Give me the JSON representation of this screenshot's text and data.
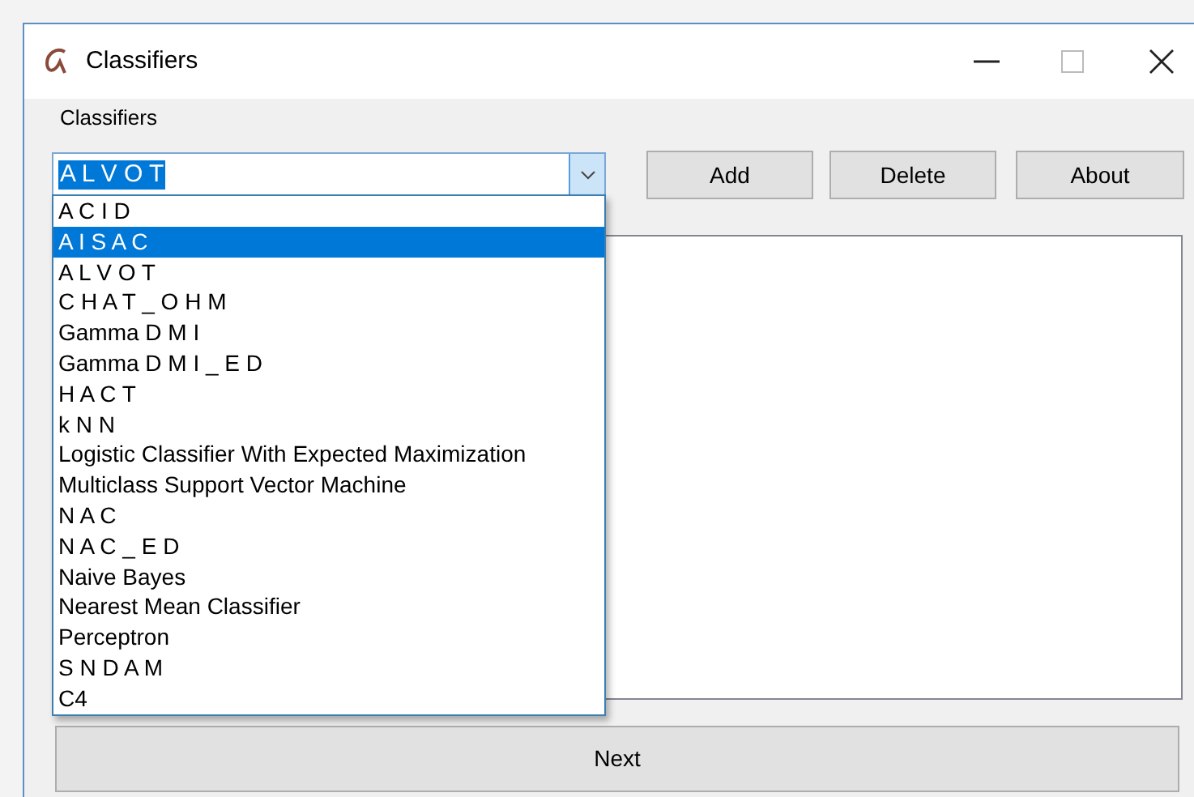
{
  "window": {
    "title": "Classifiers"
  },
  "group_label": "Classifiers",
  "combo": {
    "value": "A L V O T",
    "expanded": true
  },
  "dropdown_items": [
    {
      "label": "A C I D",
      "selected": false
    },
    {
      "label": "A I S A C",
      "selected": true
    },
    {
      "label": "A L V O T",
      "selected": false
    },
    {
      "label": "C H A T _ O H M",
      "selected": false
    },
    {
      "label": "Gamma D M I",
      "selected": false
    },
    {
      "label": "Gamma D M I _ E D",
      "selected": false
    },
    {
      "label": "H A C T",
      "selected": false
    },
    {
      "label": "k N N",
      "selected": false
    },
    {
      "label": "Logistic Classifier With Expected Maximization",
      "selected": false
    },
    {
      "label": "Multiclass Support Vector Machine",
      "selected": false
    },
    {
      "label": "N A C",
      "selected": false
    },
    {
      "label": "N A C _ E D",
      "selected": false
    },
    {
      "label": "Naive Bayes",
      "selected": false
    },
    {
      "label": "Nearest Mean Classifier",
      "selected": false
    },
    {
      "label": "Perceptron",
      "selected": false
    },
    {
      "label": "S N D A M",
      "selected": false
    },
    {
      "label": "C4",
      "selected": false
    }
  ],
  "buttons": [
    "Add",
    "Delete",
    "About"
  ],
  "next_button": "Next"
}
